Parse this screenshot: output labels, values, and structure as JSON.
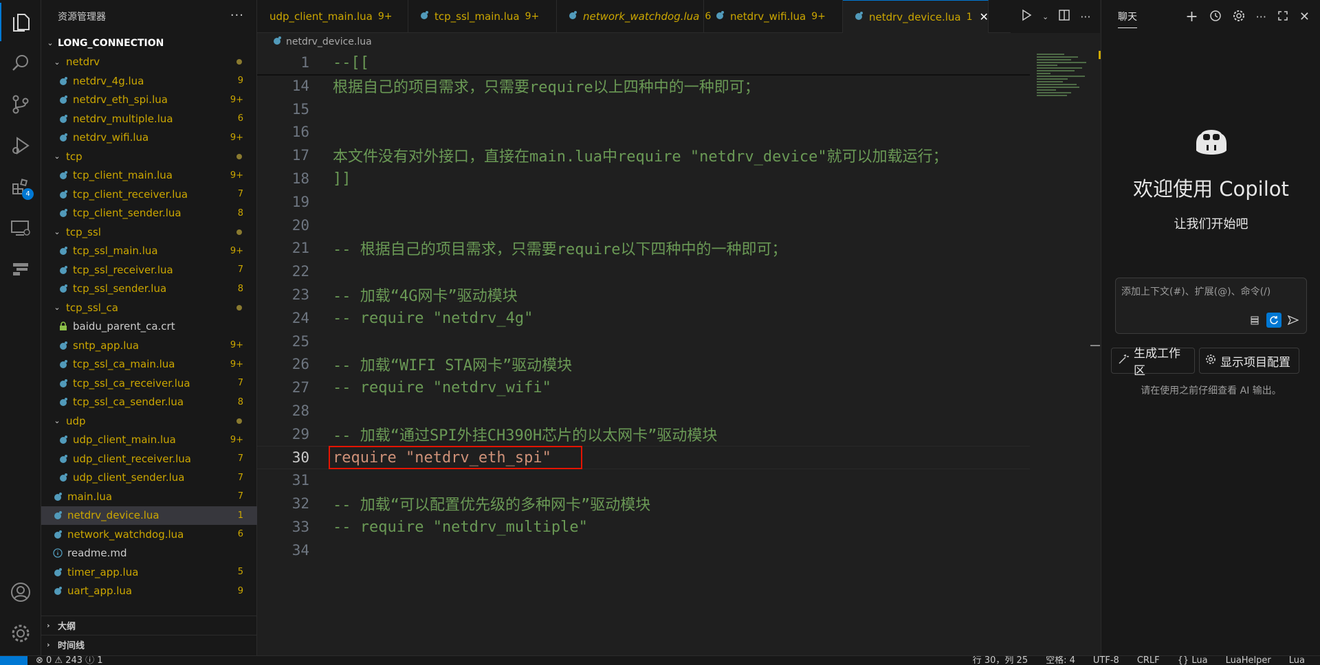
{
  "sidebar": {
    "title": "资源管理器",
    "more": "···",
    "root": "LONG_CONNECTION",
    "items": [
      {
        "name": "netdrv",
        "type": "folder",
        "indent": 1,
        "dot": true
      },
      {
        "name": "netdrv_4g.lua",
        "type": "lua",
        "indent": 2,
        "count": "9"
      },
      {
        "name": "netdrv_eth_spi.lua",
        "type": "lua",
        "indent": 2,
        "count": "9+"
      },
      {
        "name": "netdrv_multiple.lua",
        "type": "lua",
        "indent": 2,
        "count": "6"
      },
      {
        "name": "netdrv_wifi.lua",
        "type": "lua",
        "indent": 2,
        "count": "9+"
      },
      {
        "name": "tcp",
        "type": "folder",
        "indent": 1,
        "dot": true
      },
      {
        "name": "tcp_client_main.lua",
        "type": "lua",
        "indent": 2,
        "count": "9+"
      },
      {
        "name": "tcp_client_receiver.lua",
        "type": "lua",
        "indent": 2,
        "count": "7"
      },
      {
        "name": "tcp_client_sender.lua",
        "type": "lua",
        "indent": 2,
        "count": "8"
      },
      {
        "name": "tcp_ssl",
        "type": "folder",
        "indent": 1,
        "dot": true
      },
      {
        "name": "tcp_ssl_main.lua",
        "type": "lua",
        "indent": 2,
        "count": "9+"
      },
      {
        "name": "tcp_ssl_receiver.lua",
        "type": "lua",
        "indent": 2,
        "count": "7"
      },
      {
        "name": "tcp_ssl_sender.lua",
        "type": "lua",
        "indent": 2,
        "count": "8"
      },
      {
        "name": "tcp_ssl_ca",
        "type": "folder",
        "indent": 1,
        "dot": true
      },
      {
        "name": "baidu_parent_ca.crt",
        "type": "cert",
        "indent": 2,
        "count": ""
      },
      {
        "name": "sntp_app.lua",
        "type": "lua",
        "indent": 2,
        "count": "9+"
      },
      {
        "name": "tcp_ssl_ca_main.lua",
        "type": "lua",
        "indent": 2,
        "count": "9+"
      },
      {
        "name": "tcp_ssl_ca_receiver.lua",
        "type": "lua",
        "indent": 2,
        "count": "7"
      },
      {
        "name": "tcp_ssl_ca_sender.lua",
        "type": "lua",
        "indent": 2,
        "count": "8"
      },
      {
        "name": "udp",
        "type": "folder",
        "indent": 1,
        "dot": true
      },
      {
        "name": "udp_client_main.lua",
        "type": "lua",
        "indent": 2,
        "count": "9+"
      },
      {
        "name": "udp_client_receiver.lua",
        "type": "lua",
        "indent": 2,
        "count": "7"
      },
      {
        "name": "udp_client_sender.lua",
        "type": "lua",
        "indent": 2,
        "count": "7"
      },
      {
        "name": "main.lua",
        "type": "lua",
        "indent": 1,
        "count": "7"
      },
      {
        "name": "netdrv_device.lua",
        "type": "lua",
        "indent": 1,
        "count": "1",
        "selected": true
      },
      {
        "name": "network_watchdog.lua",
        "type": "lua",
        "indent": 1,
        "count": "6"
      },
      {
        "name": "readme.md",
        "type": "info",
        "indent": 1,
        "count": ""
      },
      {
        "name": "timer_app.lua",
        "type": "lua",
        "indent": 1,
        "count": "5"
      },
      {
        "name": "uart_app.lua",
        "type": "lua",
        "indent": 1,
        "count": "9"
      }
    ],
    "outline": "大纲",
    "timeline": "时间线"
  },
  "tabs": [
    {
      "name": "udp_client_main.lua",
      "count": "9+",
      "italic": false,
      "active": false,
      "partial": true
    },
    {
      "name": "tcp_ssl_main.lua",
      "count": "9+",
      "italic": false,
      "active": false
    },
    {
      "name": "network_watchdog.lua",
      "count": "6",
      "italic": true,
      "active": false
    },
    {
      "name": "netdrv_wifi.lua",
      "count": "9+",
      "italic": false,
      "active": false
    },
    {
      "name": "netdrv_device.lua",
      "count": "1",
      "italic": false,
      "active": true
    }
  ],
  "breadcrumb": "netdrv_device.lua",
  "editor": {
    "lines": [
      {
        "n": "1",
        "text": "--[[",
        "kind": "com"
      },
      {
        "n": "14",
        "text": "根据自己的项目需求，只需要require以上四种中的一种即可；",
        "kind": "com"
      },
      {
        "n": "15",
        "text": "",
        "kind": "com"
      },
      {
        "n": "16",
        "text": "",
        "kind": "com"
      },
      {
        "n": "17",
        "text": "本文件没有对外接口，直接在main.lua中require \"netdrv_device\"就可以加载运行；",
        "kind": "com"
      },
      {
        "n": "18",
        "text": "]]",
        "kind": "com"
      },
      {
        "n": "19",
        "text": "",
        "kind": "com"
      },
      {
        "n": "20",
        "text": "",
        "kind": "com"
      },
      {
        "n": "21",
        "text": "-- 根据自己的项目需求，只需要require以下四种中的一种即可；",
        "kind": "com"
      },
      {
        "n": "22",
        "text": "",
        "kind": "com"
      },
      {
        "n": "23",
        "text": "-- 加载“4G网卡”驱动模块",
        "kind": "com"
      },
      {
        "n": "24",
        "text": "-- require \"netdrv_4g\"",
        "kind": "com"
      },
      {
        "n": "25",
        "text": "",
        "kind": "com"
      },
      {
        "n": "26",
        "text": "-- 加载“WIFI STA网卡”驱动模块",
        "kind": "com"
      },
      {
        "n": "27",
        "text": "-- require \"netdrv_wifi\"",
        "kind": "com"
      },
      {
        "n": "28",
        "text": "",
        "kind": "com"
      },
      {
        "n": "29",
        "text": "-- 加载“通过SPI外挂CH390H芯片的以太网卡”驱动模块",
        "kind": "com"
      },
      {
        "n": "30",
        "text": "require \"netdrv_eth_spi\"",
        "kind": "code",
        "current": true
      },
      {
        "n": "31",
        "text": "",
        "kind": "com"
      },
      {
        "n": "32",
        "text": "-- 加载“可以配置优先级的多种网卡”驱动模块",
        "kind": "com"
      },
      {
        "n": "33",
        "text": "-- require \"netdrv_multiple\"",
        "kind": "com"
      },
      {
        "n": "34",
        "text": "",
        "kind": "com"
      }
    ]
  },
  "chat": {
    "tab": "聊天",
    "welcome": "欢迎使用 Copilot",
    "subtitle": "让我们开始吧",
    "input_placeholder": "添加上下文(#)、扩展(@)、命令(/)",
    "btn_workspace": "生成工作区",
    "btn_config": "显示项目配置",
    "disclaimer": "请在使用之前仔细查看 AI 输出。"
  },
  "status": {
    "problems": "⊗ 0 ⚠ 243 ⓘ 1",
    "position": "行 30，列 25",
    "spaces": "空格: 4",
    "encoding": "UTF-8",
    "eol": "CRLF",
    "language": "{} Lua",
    "helper": "LuaHelper",
    "lang2": "Lua"
  },
  "colors": {
    "accent": "#0078d4",
    "modified": "#cca700",
    "comment": "#6a9955",
    "string": "#ce9178",
    "highlight_box": "#e51400"
  }
}
